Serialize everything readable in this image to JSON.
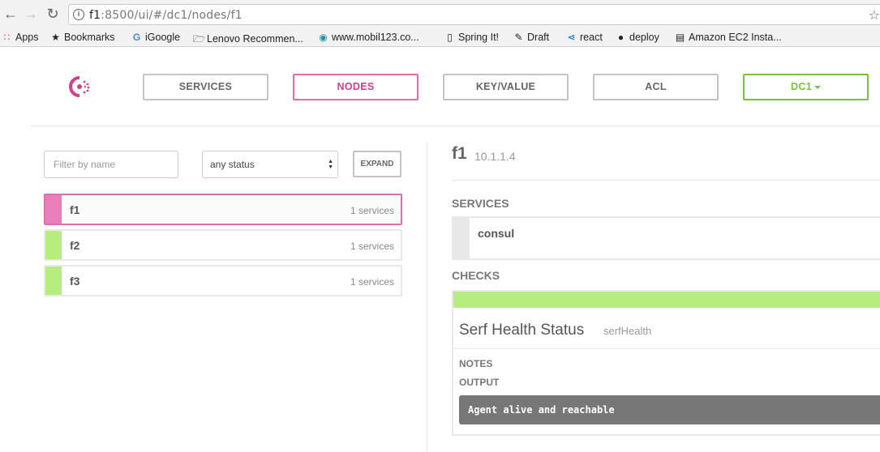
{
  "browser": {
    "url_host": "f1",
    "url_rest": ":8500/ui/#/dc1/nodes/f1",
    "bookmarks": [
      {
        "label": "Apps",
        "icon": "apps-grid-icon"
      },
      {
        "label": "Bookmarks",
        "icon": "star-icon"
      },
      {
        "label": "iGoogle",
        "icon": "google-icon"
      },
      {
        "label": "Lenovo Recommen...",
        "icon": "folder-icon"
      },
      {
        "label": "www.mobil123.co...",
        "icon": "mobil123-icon"
      },
      {
        "label": "Spring It!",
        "icon": "page-icon"
      },
      {
        "label": "Draft",
        "icon": "edit-icon"
      },
      {
        "label": "react",
        "icon": "vscode-icon"
      },
      {
        "label": "deploy",
        "icon": "github-icon"
      },
      {
        "label": "Amazon EC2 Insta...",
        "icon": "server-icon"
      }
    ]
  },
  "nav": {
    "services": "SERVICES",
    "nodes": "NODES",
    "keyvalue": "KEY/VALUE",
    "acl": "ACL",
    "dc": "DC1"
  },
  "filters": {
    "name_placeholder": "Filter by name",
    "status": "any status",
    "expand": "EXPAND"
  },
  "nodes": [
    {
      "name": "f1",
      "services": "1 services",
      "status": "active"
    },
    {
      "name": "f2",
      "services": "1 services",
      "status": "passing"
    },
    {
      "name": "f3",
      "services": "1 services",
      "status": "passing"
    }
  ],
  "detail": {
    "name": "f1",
    "address": "10.1.1.4",
    "services_heading": "SERVICES",
    "services": [
      {
        "name": "consul"
      }
    ],
    "checks_heading": "CHECKS",
    "checks": [
      {
        "name": "Serf Health Status",
        "id": "serfHealth",
        "notes_label": "NOTES",
        "output_label": "OUTPUT",
        "output": "Agent alive and reachable"
      }
    ]
  },
  "colors": {
    "accent": "#e26cac",
    "passing": "#b5ee7f",
    "dc": "#7ac143"
  }
}
